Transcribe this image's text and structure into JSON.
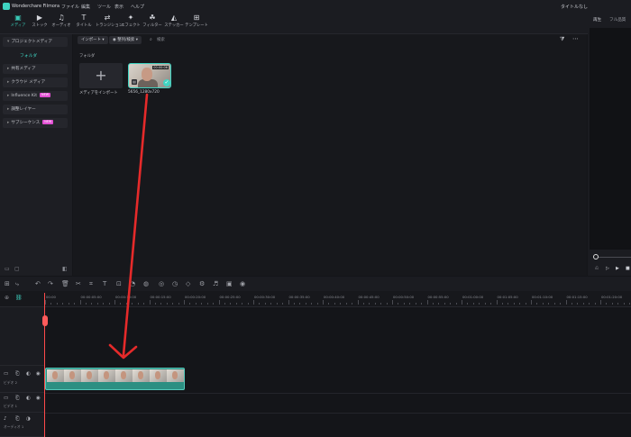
{
  "app": {
    "title": "Wonderchare Filmora",
    "menu": [
      "ファイル",
      "編集",
      "ツール",
      "表示",
      "ヘルプ"
    ],
    "project_title": "タイトルなし"
  },
  "toolbar": {
    "items": [
      {
        "label": "メディア",
        "icon": "media-icon",
        "active": true
      },
      {
        "label": "ストック",
        "icon": "stock-icon"
      },
      {
        "label": "オーディオ",
        "icon": "audio-icon"
      },
      {
        "label": "タイトル",
        "icon": "title-icon"
      },
      {
        "label": "トランジション",
        "icon": "transition-icon"
      },
      {
        "label": "エフェクト",
        "icon": "effect-icon"
      },
      {
        "label": "フィルター",
        "icon": "filter-icon"
      },
      {
        "label": "ステッカー",
        "icon": "sticker-icon"
      },
      {
        "label": "テンプレート",
        "icon": "template-icon"
      }
    ]
  },
  "sidebar": {
    "project_media": "プロジェクトメディア",
    "folder": "フォルダ",
    "items": [
      {
        "label": "共有メディア"
      },
      {
        "label": "クラウド メディア"
      },
      {
        "label": "Influence Kit",
        "badge": "NEW"
      },
      {
        "label": "調整レイヤー"
      },
      {
        "label": "サブシーケンス",
        "badge": "NEW"
      }
    ]
  },
  "media_panel": {
    "import_button": "インポート",
    "sort_button": "整列/検索",
    "search_placeholder": "検索",
    "folder_header": "フォルダ",
    "import_tile_label": "メディアをインポート",
    "clip_name": "5656_1280x720",
    "clip_duration": "00:00:06"
  },
  "preview": {
    "tab_playback": "再生",
    "tab_full_quality": "フル品質"
  },
  "timeline": {
    "ruler_labels": [
      "00:00",
      "00:00:05:00",
      "00:00:10:00",
      "00:00:15:00",
      "00:00:20:00",
      "00:00:25:00",
      "00:00:30:00",
      "00:00:35:00",
      "00:00:40:00",
      "00:00:45:00",
      "00:00:50:00",
      "00:00:55:00",
      "00:01:00:00",
      "00:01:05:00",
      "00:01:10:00",
      "00:01:15:00",
      "00:01:20:00"
    ],
    "tracks": [
      {
        "name": "ビデオ 2"
      },
      {
        "name": "ビデオ 1"
      },
      {
        "name": "オーディオ 1"
      }
    ]
  },
  "colors": {
    "accent": "#3fd4c2",
    "annotation_arrow": "#e52a2a",
    "playhead": "#ff4a4a"
  }
}
